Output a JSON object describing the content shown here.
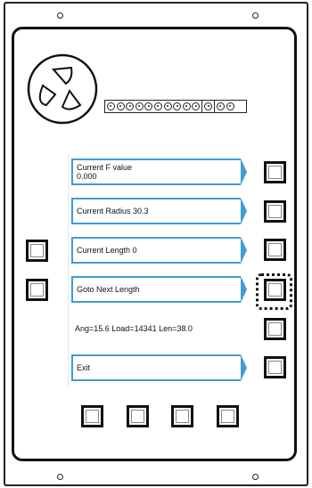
{
  "menu_buttons": [
    {
      "line1": "Current F value",
      "line2": "0.000"
    },
    {
      "line1": "Current Radius 30.3",
      "line2": ""
    },
    {
      "line1": "Current Length 0",
      "line2": ""
    },
    {
      "line1": "Goto Next Length",
      "line2": ""
    },
    {
      "line1": "Exit",
      "line2": ""
    }
  ],
  "status_line": "Ang=15.6 Load=14341 Len=38.0",
  "colors": {
    "menu_accent": "#3f9cd6",
    "frame": "#111111"
  },
  "icons": {
    "fan": "fan-icon",
    "connector": "connector-pins-icon"
  },
  "selected_key": "right-softkey-4"
}
